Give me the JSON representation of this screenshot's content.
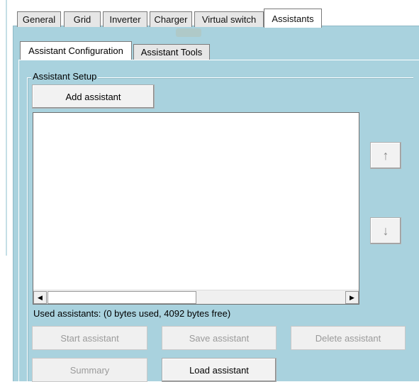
{
  "tabs": [
    {
      "label": "General"
    },
    {
      "label": "Grid"
    },
    {
      "label": "Inverter"
    },
    {
      "label": "Charger"
    },
    {
      "label": "Virtual switch"
    },
    {
      "label": "Assistants",
      "active": true
    }
  ],
  "subtabs": [
    {
      "label": "Assistant Configuration",
      "active": true
    },
    {
      "label": "Assistant Tools"
    }
  ],
  "setup": {
    "group_label": "Assistant Setup",
    "add_button": "Add assistant",
    "up_icon": "arrow-up",
    "down_icon": "arrow-down",
    "up_glyph": "↑",
    "down_glyph": "↓"
  },
  "scrollbar": {
    "left_glyph": "◀",
    "right_glyph": "▶"
  },
  "status_text": "Used assistants: (0 bytes used, 4092 bytes free)",
  "buttons": {
    "start": "Start assistant",
    "save": "Save assistant",
    "delete": "Delete assistant",
    "summary": "Summary",
    "load": "Load assistant"
  },
  "colors": {
    "panel": "#a9d2de",
    "tab_bg": "#e6e6e6",
    "active_tab": "#ffffff"
  }
}
